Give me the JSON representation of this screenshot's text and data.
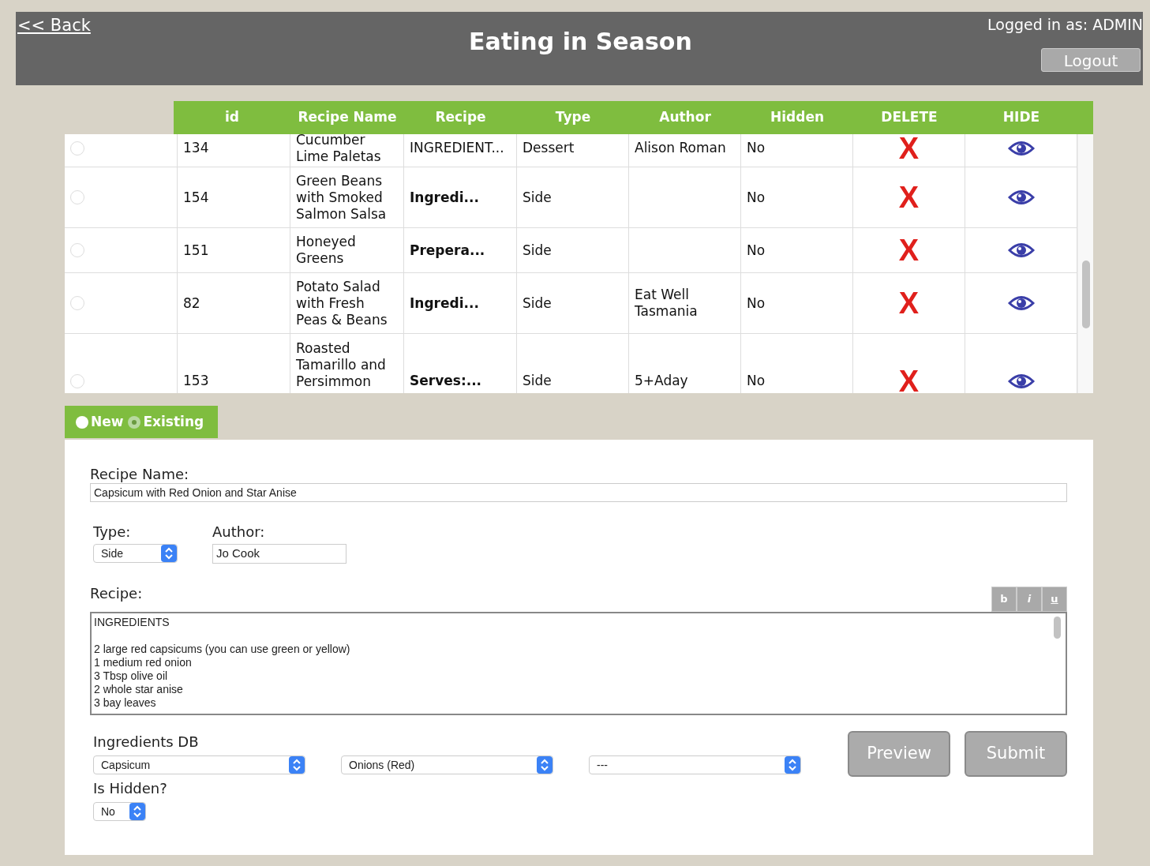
{
  "header": {
    "back_link": "<< Back",
    "title": "Eating in Season",
    "logged_in": "Logged in as: ADMIN",
    "logout_button": "Logout"
  },
  "table": {
    "columns": [
      "id",
      "Recipe Name",
      "Recipe",
      "Type",
      "Author",
      "Hidden",
      "DELETE",
      "HIDE"
    ],
    "rows": [
      {
        "selected": false,
        "id": "134",
        "name": "Cucumber Lime Paletas",
        "recipe": "INGREDIENT...",
        "recipe_bold": false,
        "type": "Dessert",
        "author": "Alison Roman",
        "hidden": "No",
        "delete": "X"
      },
      {
        "selected": false,
        "id": "154",
        "name": "Green Beans with Smoked Salmon Salsa",
        "recipe": "Ingredi...",
        "recipe_bold": true,
        "type": "Side",
        "hidden": "No",
        "delete": "X"
      },
      {
        "selected": false,
        "id": "151",
        "name": "Honeyed Greens",
        "recipe": "Prepera...",
        "recipe_bold": true,
        "type": "Side",
        "hidden": "No",
        "delete": "X"
      },
      {
        "selected": false,
        "id": "82",
        "name": "Potato Salad with Fresh Peas & Beans",
        "recipe": "Ingredi...",
        "recipe_bold": true,
        "type": "Side",
        "author": "Eat Well Tasmania",
        "hidden": "No",
        "delete": "X"
      },
      {
        "selected": false,
        "id": "153",
        "name": "Roasted Tamarillo and Persimmon",
        "recipe": "Serves:...",
        "recipe_bold": true,
        "type": "Side",
        "author": "5+Aday",
        "hidden": "No",
        "delete": "X"
      }
    ]
  },
  "mode_tabs": [
    {
      "label": "New",
      "selected": false
    },
    {
      "label": "Existing",
      "selected": true
    }
  ],
  "form": {
    "recipe_name_label": "Recipe Name:",
    "recipe_name": "Capsicum with Red Onion and Star Anise",
    "type_label": "Type:",
    "type": "Side",
    "author_label": "Author:",
    "author": "Jo Cook",
    "recipe_label": "Recipe:",
    "format_buttons": [
      "b",
      "i",
      "u"
    ],
    "recipe_lines": [
      "INGREDIENTS",
      "2 large red capsicums (you can use green or yellow)",
      "1 medium red onion",
      "3 Tbsp olive oil",
      "2 whole star anise",
      "3 bay leaves"
    ],
    "ingredients_label": "Ingredients DB",
    "ingredients": [
      "Capsicum",
      "Onions (Red)",
      "---"
    ],
    "hidden_label": "Is Hidden?",
    "hidden": "No",
    "preview_button": "Preview",
    "submit_button": "Submit"
  }
}
